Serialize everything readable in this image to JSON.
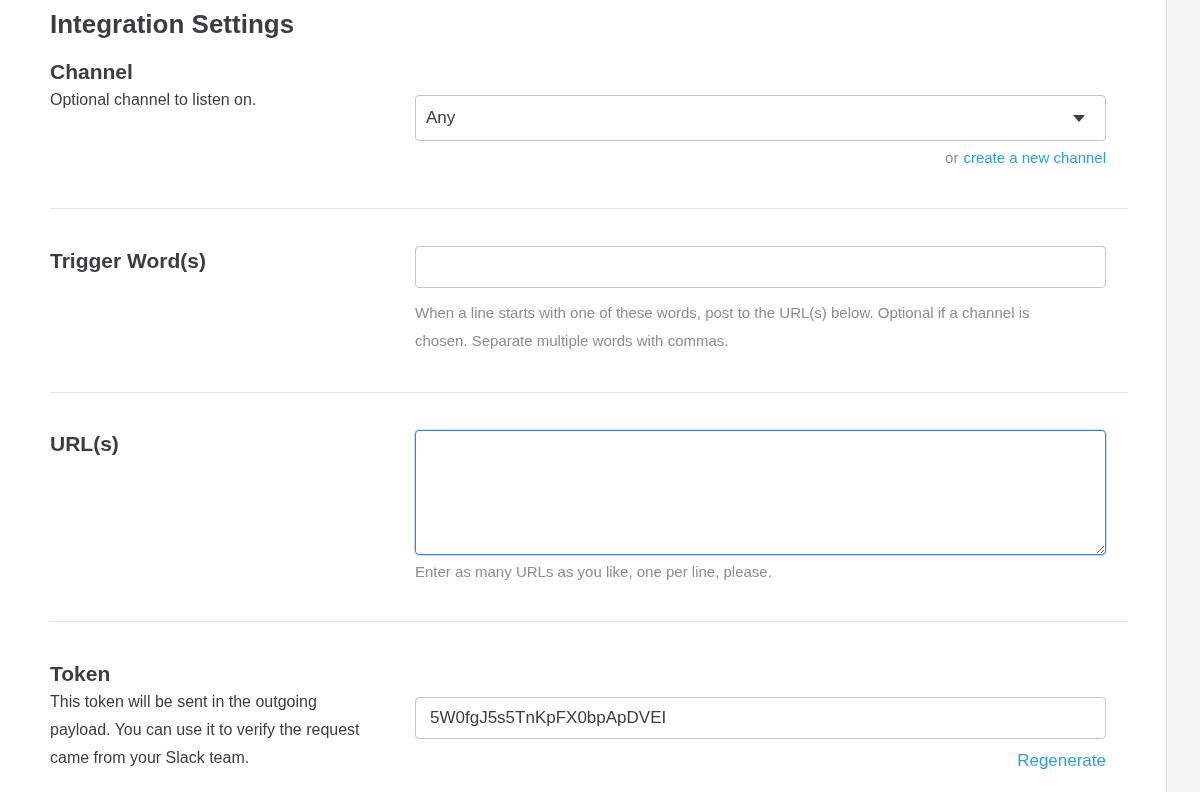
{
  "title": "Integration Settings",
  "sections": [
    {
      "kind": "select",
      "label": "Channel",
      "description": "Optional channel to listen on.",
      "value": "Any",
      "link_prefix": "or",
      "link": "create a new channel"
    },
    {
      "kind": "input",
      "label": "Trigger Word(s)",
      "hint": "When a line starts with one of these words, post to the URL(s) below. Optional if a channel is chosen. Separate multiple words with commas.",
      "focused": false
    },
    {
      "kind": "textarea",
      "label": "URL(s)",
      "hint": "Enter as many URLs as you like, one per line, please.",
      "focused": true
    },
    {
      "kind": "token",
      "label": "Token",
      "description": "This token will be sent in the outgoing payload. You can use it to verify the request came from your Slack team.",
      "value": "5W0fgJ5s5TnKpFX0bpApDVEI",
      "link": "Regenerate"
    }
  ]
}
